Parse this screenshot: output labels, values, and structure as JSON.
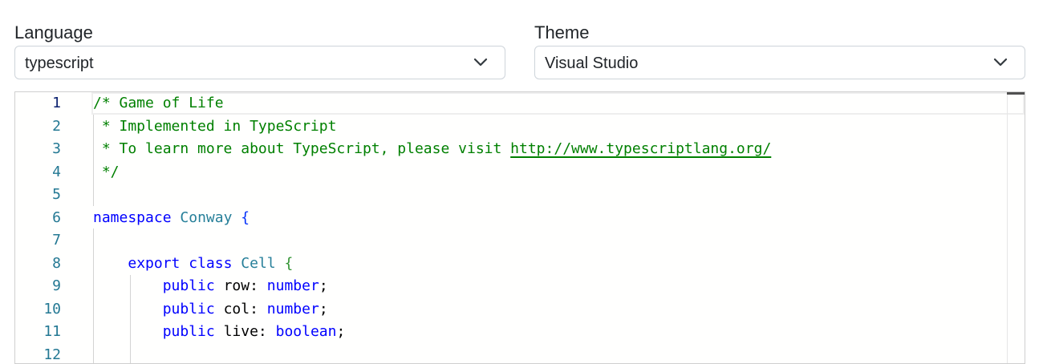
{
  "language": {
    "label": "Language",
    "selected": "typescript"
  },
  "theme": {
    "label": "Theme",
    "selected": "Visual Studio"
  },
  "editor": {
    "line_numbers": [
      "1",
      "2",
      "3",
      "4",
      "5",
      "6",
      "7",
      "8",
      "9",
      "10",
      "11",
      "12"
    ],
    "lines": [
      [
        {
          "t": "comment",
          "v": "/* Game of Life"
        }
      ],
      [
        {
          "t": "comment",
          "v": " * Implemented in TypeScript"
        }
      ],
      [
        {
          "t": "comment",
          "v": " * To learn more about TypeScript, please visit "
        },
        {
          "t": "link",
          "v": "http://www.typescriptlang.org/"
        }
      ],
      [
        {
          "t": "comment",
          "v": " */"
        }
      ],
      [],
      [
        {
          "t": "keyword",
          "v": "namespace"
        },
        {
          "t": "ident",
          "v": " "
        },
        {
          "t": "type",
          "v": "Conway"
        },
        {
          "t": "ident",
          "v": " "
        },
        {
          "t": "brace",
          "v": "{"
        }
      ],
      [],
      [
        {
          "t": "ident",
          "v": "    "
        },
        {
          "t": "keyword",
          "v": "export"
        },
        {
          "t": "ident",
          "v": " "
        },
        {
          "t": "keyword",
          "v": "class"
        },
        {
          "t": "ident",
          "v": " "
        },
        {
          "t": "type",
          "v": "Cell"
        },
        {
          "t": "ident",
          "v": " "
        },
        {
          "t": "cellbrace",
          "v": "{"
        }
      ],
      [
        {
          "t": "ident",
          "v": "        "
        },
        {
          "t": "keyword",
          "v": "public"
        },
        {
          "t": "ident",
          "v": " row"
        },
        {
          "t": "punct",
          "v": ": "
        },
        {
          "t": "keyword",
          "v": "number"
        },
        {
          "t": "punct",
          "v": ";"
        }
      ],
      [
        {
          "t": "ident",
          "v": "        "
        },
        {
          "t": "keyword",
          "v": "public"
        },
        {
          "t": "ident",
          "v": " col"
        },
        {
          "t": "punct",
          "v": ": "
        },
        {
          "t": "keyword",
          "v": "number"
        },
        {
          "t": "punct",
          "v": ";"
        }
      ],
      [
        {
          "t": "ident",
          "v": "        "
        },
        {
          "t": "keyword",
          "v": "public"
        },
        {
          "t": "ident",
          "v": " live"
        },
        {
          "t": "punct",
          "v": ": "
        },
        {
          "t": "keyword",
          "v": "boolean"
        },
        {
          "t": "punct",
          "v": ";"
        }
      ],
      []
    ]
  },
  "icons": {
    "language_dropdown": "chevron-down-icon",
    "theme_dropdown": "chevron-down-icon"
  },
  "colors": {
    "comment": "#008000",
    "keyword": "#0000ff",
    "type": "#267f99",
    "line_number": "#237893"
  }
}
